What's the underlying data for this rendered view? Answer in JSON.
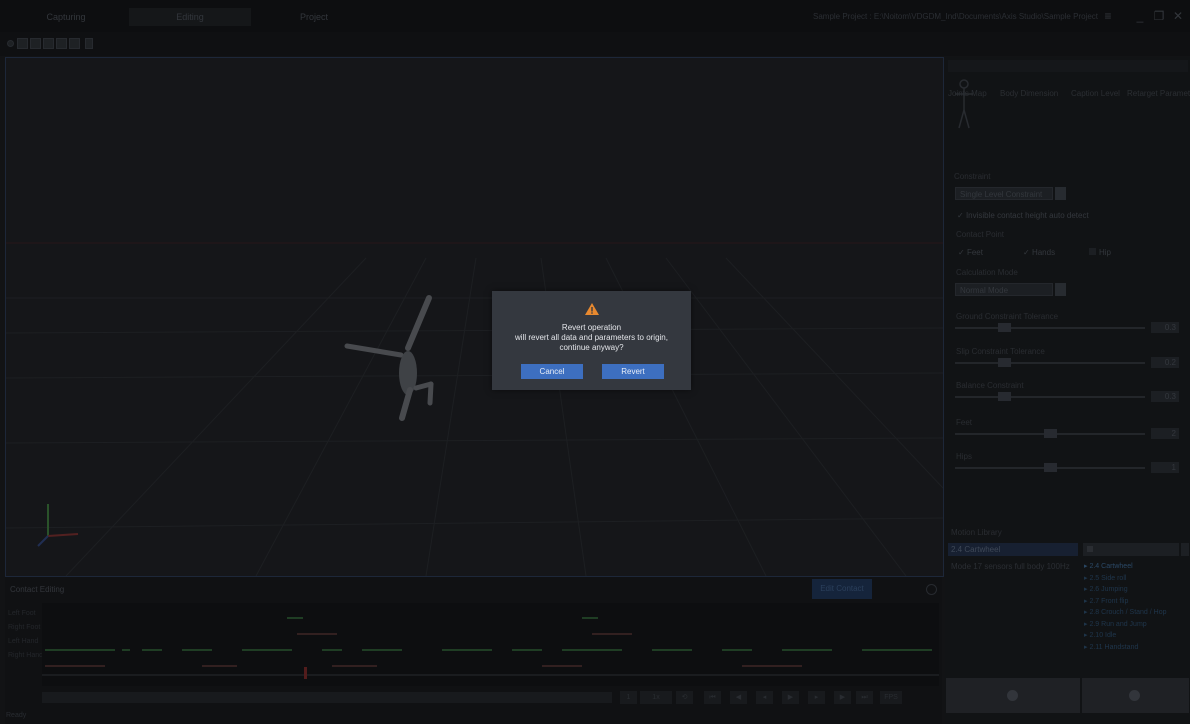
{
  "tabs": [
    "Capturing",
    "Editing",
    "Project"
  ],
  "active_tab": 1,
  "project_path": "Sample Project : E:\\Noitom\\VDGDM_Ind\\Documents\\Axis Studio\\Sample Project",
  "window": {
    "menu_icon": "hamburger-icon",
    "minimize": "_",
    "restore": "❐",
    "close": "✕"
  },
  "right_panel": {
    "tabs": [
      "Joints Map",
      "Body Dimension",
      "Caption Level",
      "Retarget Parameters"
    ],
    "section_mode": "Constraint",
    "mode_select": "Single Level Constraint",
    "auto_detect_label": "Invisible contact height auto detect",
    "contact_label": "Contact Point",
    "contact_options": [
      {
        "label": "Feet",
        "checked": true
      },
      {
        "label": "Hands",
        "checked": true
      },
      {
        "label": "Hip",
        "checked": false
      }
    ],
    "calc_label": "Calculation Mode",
    "calc_select": "Normal Mode",
    "sliders": [
      {
        "label": "Ground Constraint Tolerance",
        "value": "0.3",
        "pos": 0.26
      },
      {
        "label": "Slip Constraint Tolerance",
        "value": "0.2",
        "pos": 0.26
      },
      {
        "label": "Balance Constraint",
        "value": "0.3",
        "pos": 0.26
      },
      {
        "label": "Feet",
        "value": "2",
        "pos": 0.5
      },
      {
        "label": "Hips",
        "value": "1",
        "pos": 0.5
      }
    ],
    "motion_title": "Motion Library",
    "motion_selected": "2.4 Cartwheel",
    "motion_desc": "Mode 17 sensors full body 100Hz",
    "motion_list": [
      "2.4 Cartwheel",
      "2.5 Side roll",
      "2.6 Jumping",
      "2.7 Front flip",
      "2.8 Crouch / Stand / Hop",
      "2.9 Run and Jump",
      "2.10 Idle",
      "2.11 Handstand"
    ]
  },
  "bottom": {
    "title": "Contact Editing",
    "edit_button": "Edit Contact",
    "track_labels": [
      "Left Foot",
      "Right Foot",
      "Left Hand",
      "Right Hand"
    ],
    "status": "Ready",
    "frame": "1",
    "playback_rate": "1x",
    "fps_label": "FPS"
  },
  "dialog": {
    "title": "Revert operation",
    "message": "will revert all data and parameters to origin, continue anyway?",
    "cancel": "Cancel",
    "confirm": "Revert"
  }
}
